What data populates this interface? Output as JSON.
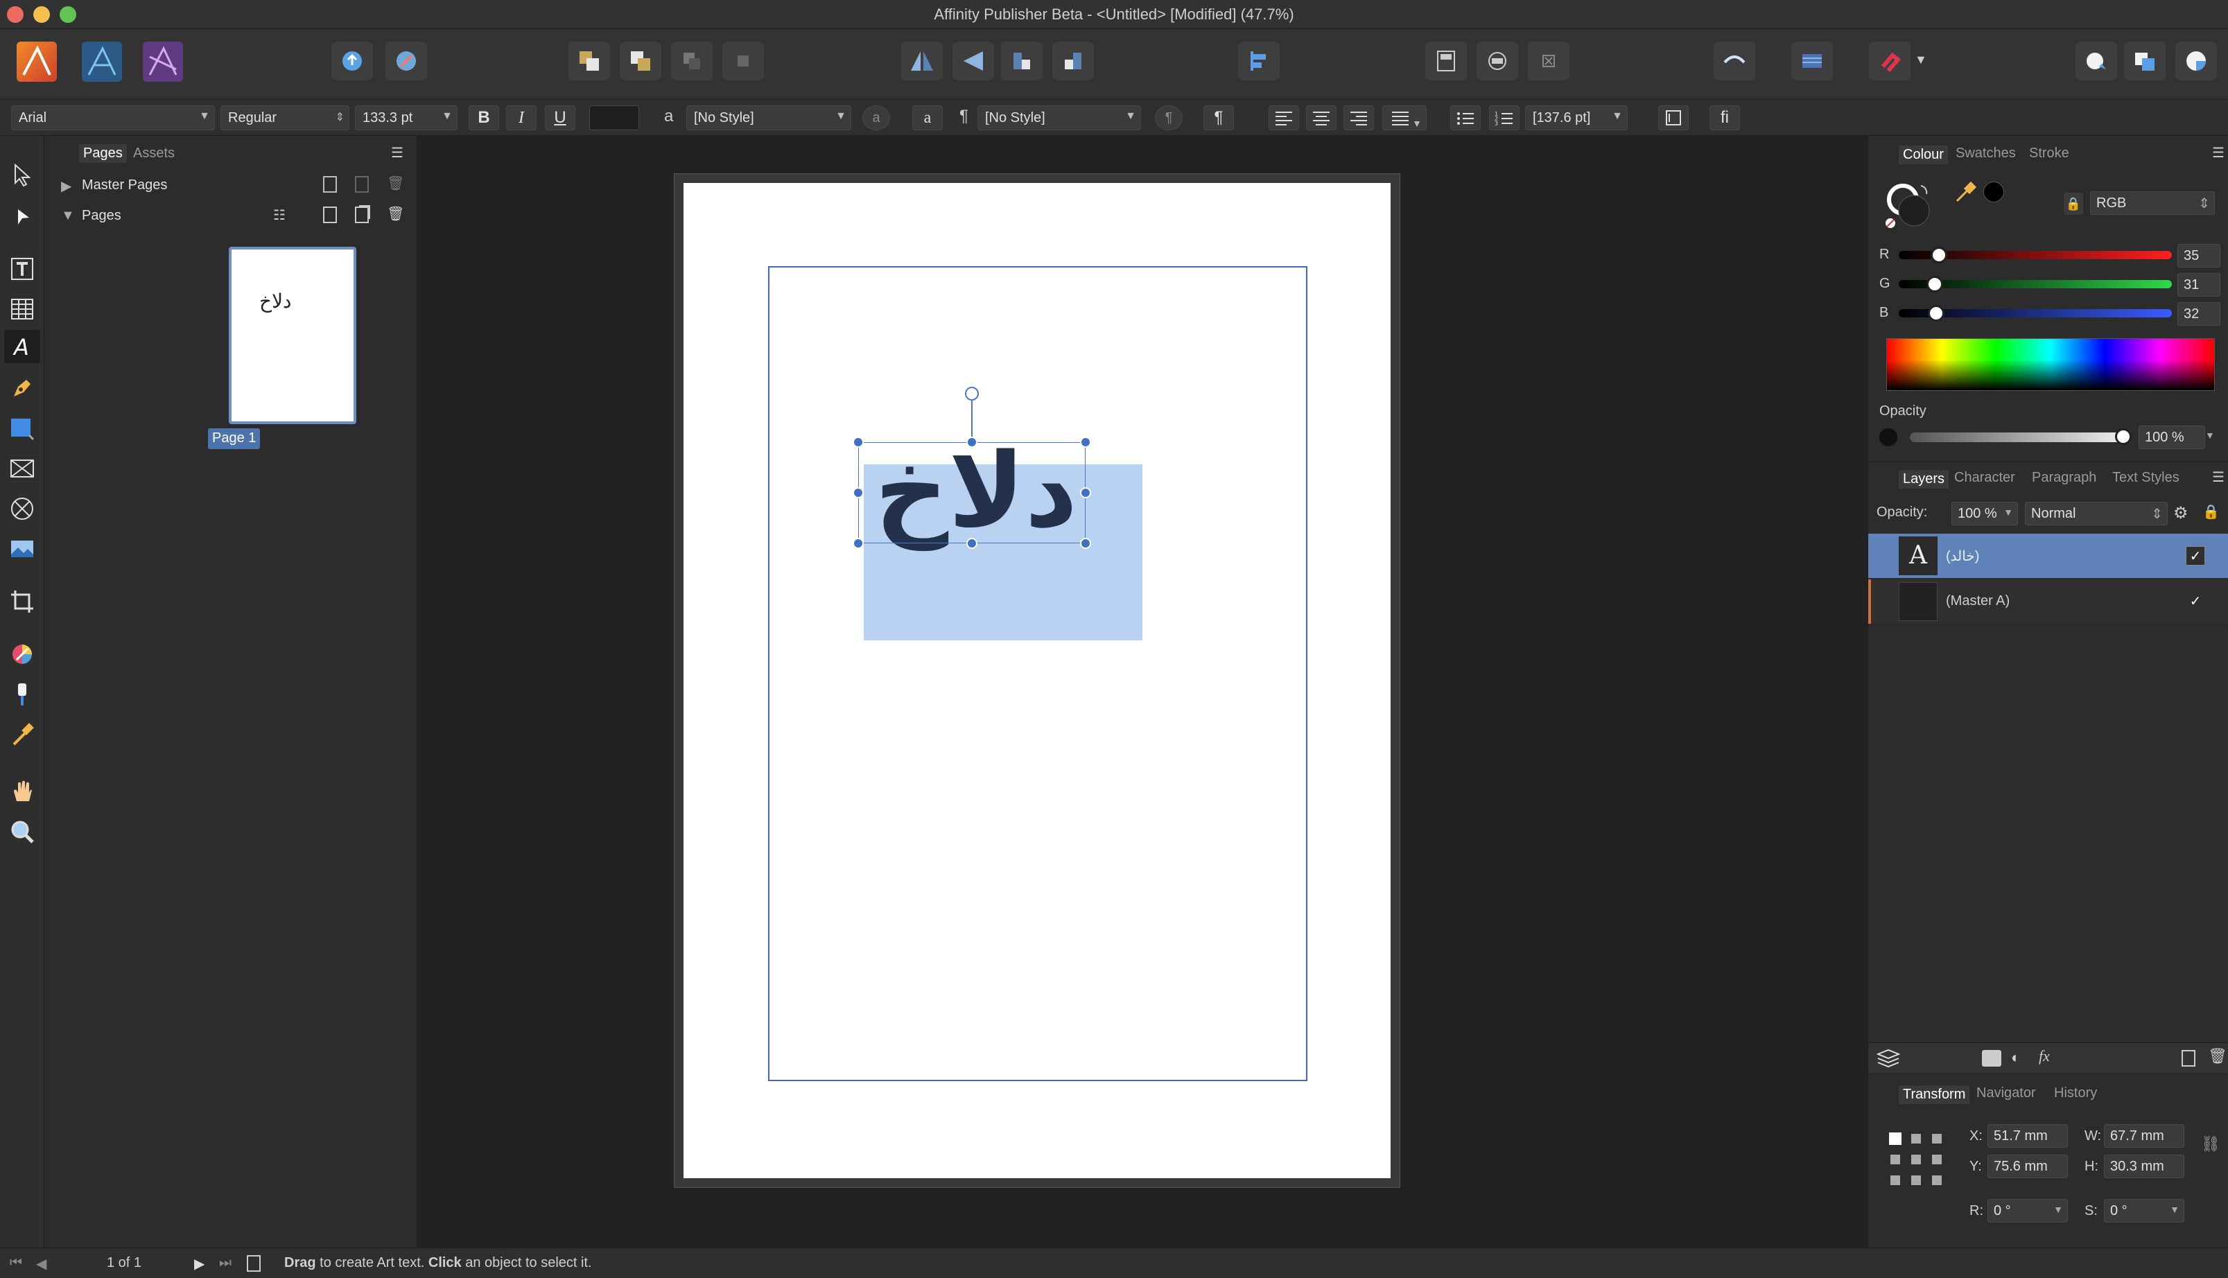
{
  "window": {
    "title": "Affinity Publisher Beta - <Untitled> [Modified] (47.7%)"
  },
  "colors": {
    "accent": "#3f75c9",
    "selection": "#b9d2f2",
    "text_fill": "#23314a",
    "window_bg": "#2b2b2b"
  },
  "context": {
    "font": "Arial",
    "weight": "Regular",
    "size": "133.3 pt",
    "bold": "B",
    "italic": "I",
    "underline": "U",
    "char_style": "[No Style]",
    "char_icon": "a",
    "para_style": "[No Style]",
    "para_mark": "¶",
    "leading": "[137.6 pt]",
    "ligature": "fi"
  },
  "pages_panel": {
    "tabs": [
      "Pages",
      "Assets"
    ],
    "master_pages": "Master Pages",
    "pages": "Pages",
    "thumb_text": "دلاخ",
    "page_label": "Page 1"
  },
  "document": {
    "art_text": "دلاخ"
  },
  "colour_panel": {
    "tabs": [
      "Colour",
      "Swatches",
      "Stroke"
    ],
    "model": "RGB",
    "r": {
      "label": "R",
      "value": "35"
    },
    "g": {
      "label": "G",
      "value": "31"
    },
    "b": {
      "label": "B",
      "value": "32"
    },
    "opacity_label": "Opacity",
    "opacity_value": "100 %"
  },
  "layers_panel": {
    "tabs": [
      "Layers",
      "Character",
      "Paragraph",
      "Text Styles"
    ],
    "opacity_label": "Opacity:",
    "opacity_value": "100 %",
    "blend": "Normal",
    "layers": [
      {
        "name": "(خالد)",
        "icon": "A"
      },
      {
        "name": "(Master A)"
      }
    ]
  },
  "transform_panel": {
    "tabs": [
      "Transform",
      "Navigator",
      "History"
    ],
    "x_label": "X:",
    "x": "51.7 mm",
    "y_label": "Y:",
    "y": "75.6 mm",
    "w_label": "W:",
    "w": "67.7 mm",
    "h_label": "H:",
    "h": "30.3 mm",
    "r_label": "R:",
    "r": "0 °",
    "s_label": "S:",
    "s": "0 °"
  },
  "status": {
    "page_count": "1 of 1",
    "drag": "Drag",
    "msg1": " to create Art text. ",
    "click": "Click",
    "msg2": " an object to select it."
  }
}
